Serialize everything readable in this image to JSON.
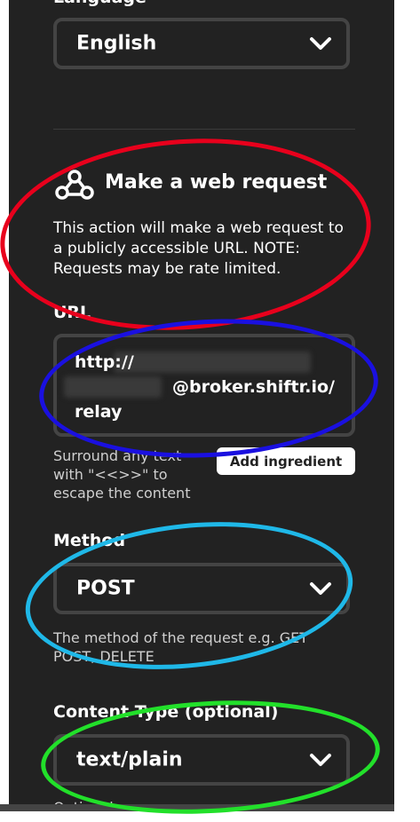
{
  "language": {
    "label": "Language",
    "value": "English"
  },
  "action": {
    "title": "Make a web request",
    "description": "This action will make a web request to a publicly accessible URL. NOTE: Requests may be rate limited.",
    "icon": "webhook-icon"
  },
  "url": {
    "label": "URL",
    "value": "http://                :                @broker.shiftr.io/relay",
    "visible_part": "@broker.shiftr.io/relay",
    "help": "Surround any text with \"<<>>\" to escape the content",
    "add_ingredient": "Add ingredient"
  },
  "method": {
    "label": "Method",
    "value": "POST",
    "help": "The method of the request e.g. GET POST, DELETE"
  },
  "content_type": {
    "label": "Content Type (optional)",
    "value": "text/plain",
    "help": "Optional"
  },
  "colors": {
    "panel_bg": "#222222",
    "field_border": "#444444",
    "annotation_red": "#e8001c",
    "annotation_blue": "#1a10e0",
    "annotation_cyan": "#1fb8e8",
    "annotation_green": "#22e02a"
  }
}
